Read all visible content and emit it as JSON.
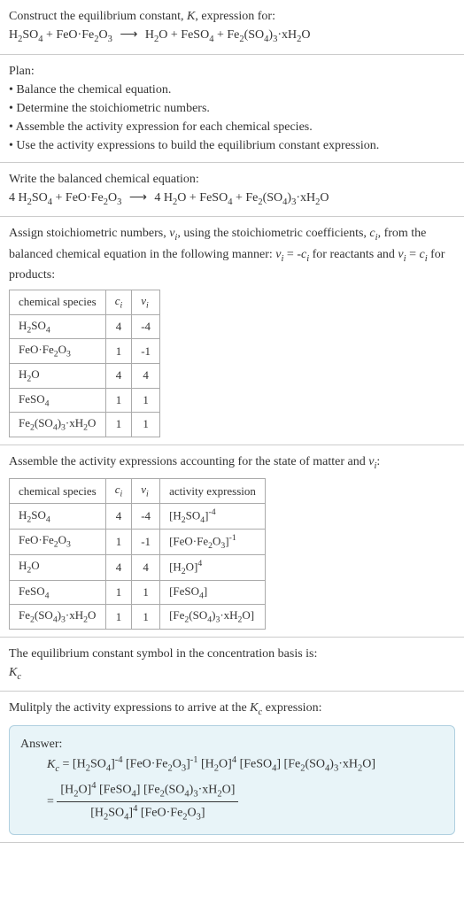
{
  "intro": {
    "line1": "Construct the equilibrium constant, K, expression for:",
    "equation": "H₂SO₄ + FeO·Fe₂O₃ ⟶ H₂O + FeSO₄ + Fe₂(SO₄)₃·xH₂O"
  },
  "plan": {
    "title": "Plan:",
    "items": [
      "• Balance the chemical equation.",
      "• Determine the stoichiometric numbers.",
      "• Assemble the activity expression for each chemical species.",
      "• Use the activity expressions to build the equilibrium constant expression."
    ]
  },
  "balanced": {
    "title": "Write the balanced chemical equation:",
    "equation": "4 H₂SO₄ + FeO·Fe₂O₃ ⟶ 4 H₂O + FeSO₄ + Fe₂(SO₄)₃·xH₂O"
  },
  "stoich": {
    "intro": "Assign stoichiometric numbers, νᵢ, using the stoichiometric coefficients, cᵢ, from the balanced chemical equation in the following manner: νᵢ = -cᵢ for reactants and νᵢ = cᵢ for products:",
    "headers": [
      "chemical species",
      "cᵢ",
      "νᵢ"
    ],
    "rows": [
      [
        "H₂SO₄",
        "4",
        "-4"
      ],
      [
        "FeO·Fe₂O₃",
        "1",
        "-1"
      ],
      [
        "H₂O",
        "4",
        "4"
      ],
      [
        "FeSO₄",
        "1",
        "1"
      ],
      [
        "Fe₂(SO₄)₃·xH₂O",
        "1",
        "1"
      ]
    ]
  },
  "activity": {
    "intro": "Assemble the activity expressions accounting for the state of matter and νᵢ:",
    "headers": [
      "chemical species",
      "cᵢ",
      "νᵢ",
      "activity expression"
    ],
    "rows": [
      [
        "H₂SO₄",
        "4",
        "-4",
        "[H₂SO₄]⁻⁴"
      ],
      [
        "FeO·Fe₂O₃",
        "1",
        "-1",
        "[FeO·Fe₂O₃]⁻¹"
      ],
      [
        "H₂O",
        "4",
        "4",
        "[H₂O]⁴"
      ],
      [
        "FeSO₄",
        "1",
        "1",
        "[FeSO₄]"
      ],
      [
        "Fe₂(SO₄)₃·xH₂O",
        "1",
        "1",
        "[Fe₂(SO₄)₃·xH₂O]"
      ]
    ]
  },
  "symbol": {
    "line1": "The equilibrium constant symbol in the concentration basis is:",
    "line2": "K_c"
  },
  "multiply": {
    "intro": "Mulitply the activity expressions to arrive at the K_c expression:"
  },
  "answer": {
    "label": "Answer:",
    "linear": "K_c = [H₂SO₄]⁻⁴ [FeO·Fe₂O₃]⁻¹ [H₂O]⁴ [FeSO₄] [Fe₂(SO₄)₃·xH₂O]",
    "frac_num": "[H₂O]⁴ [FeSO₄] [Fe₂(SO₄)₃·xH₂O]",
    "frac_den": "[H₂SO₄]⁴ [FeO·Fe₂O₃]"
  }
}
